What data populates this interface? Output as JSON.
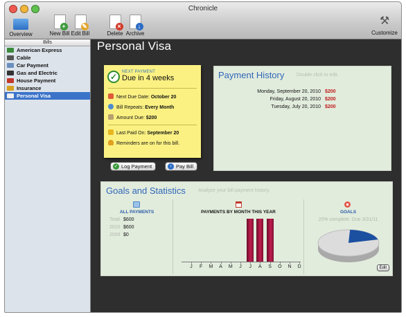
{
  "window": {
    "title": "Chronicle"
  },
  "toolbar": {
    "overview": "Overview",
    "new_bill": "New Bill",
    "edit_bill": "Edit Bill",
    "delete": "Delete",
    "archive": "Archive",
    "customize": "Customize"
  },
  "sidebar": {
    "header": "Bills",
    "items": [
      {
        "label": "American Express",
        "icon": "card-icon",
        "color": "#3a8a3a"
      },
      {
        "label": "Cable",
        "icon": "tv-icon",
        "color": "#555555"
      },
      {
        "label": "Car Payment",
        "icon": "car-icon",
        "color": "#6a8fbf"
      },
      {
        "label": "Gas and Electric",
        "icon": "plug-icon",
        "color": "#333333"
      },
      {
        "label": "House Payment",
        "icon": "house-icon",
        "color": "#c0392b"
      },
      {
        "label": "Insurance",
        "icon": "umbrella-icon",
        "color": "#d6a020"
      },
      {
        "label": "Personal Visa",
        "icon": "card-icon",
        "color": "#f0f0f0",
        "selected": true
      }
    ]
  },
  "main": {
    "title": "Personal Visa"
  },
  "note": {
    "next_payment_label": "NEXT PAYMENT",
    "due_text": "Due in 4 weeks",
    "next_due_label": "Next Due Date:",
    "next_due_value": "October 20",
    "repeats_label": "Bill Repeats:",
    "repeats_value": "Every Month",
    "amount_label": "Amount Due:",
    "amount_value": "$200",
    "last_paid_label": "Last Paid On:",
    "last_paid_value": "September 20",
    "reminders_text": "Reminders are on for this bill."
  },
  "buttons": {
    "log_payment": "Log Payment",
    "pay_bill": "Pay Bill",
    "edit": "Edit"
  },
  "payment_history": {
    "title": "Payment History",
    "hint": "Double click to edit.",
    "rows": [
      {
        "date": "Monday, September 20, 2010",
        "amount": "$200"
      },
      {
        "date": "Friday, August 20, 2010",
        "amount": "$200"
      },
      {
        "date": "Tuesday, July 20, 2010",
        "amount": "$200"
      }
    ]
  },
  "goals_stats": {
    "title": "Goals and Statistics",
    "subtitle": "Analyze your bill payment history.",
    "all_payments": {
      "heading": "ALL PAYMENTS",
      "rows": [
        {
          "key": "Total",
          "value": "$600"
        },
        {
          "key": "2010",
          "value": "$600"
        },
        {
          "key": "2009",
          "value": "$0"
        }
      ]
    },
    "by_month": {
      "heading": "PAYMENTS BY MONTH THIS YEAR"
    },
    "goals": {
      "heading": "GOALS",
      "text": "20% complete. Due 3/31/11"
    }
  },
  "chart_data": {
    "type": "bar",
    "title": "PAYMENTS BY MONTH THIS YEAR",
    "categories": [
      "J",
      "F",
      "M",
      "A",
      "M",
      "J",
      "J",
      "A",
      "S",
      "O",
      "N",
      "D"
    ],
    "values": [
      0,
      0,
      0,
      0,
      0,
      0,
      200,
      200,
      200,
      0,
      0,
      0
    ],
    "ylim": [
      0,
      200
    ],
    "color": "#a8163f"
  },
  "goal_pie": {
    "type": "pie",
    "complete_fraction": 0.2,
    "complete_color": "#1b4fa0",
    "remaining_color": "#dcdcdc"
  }
}
